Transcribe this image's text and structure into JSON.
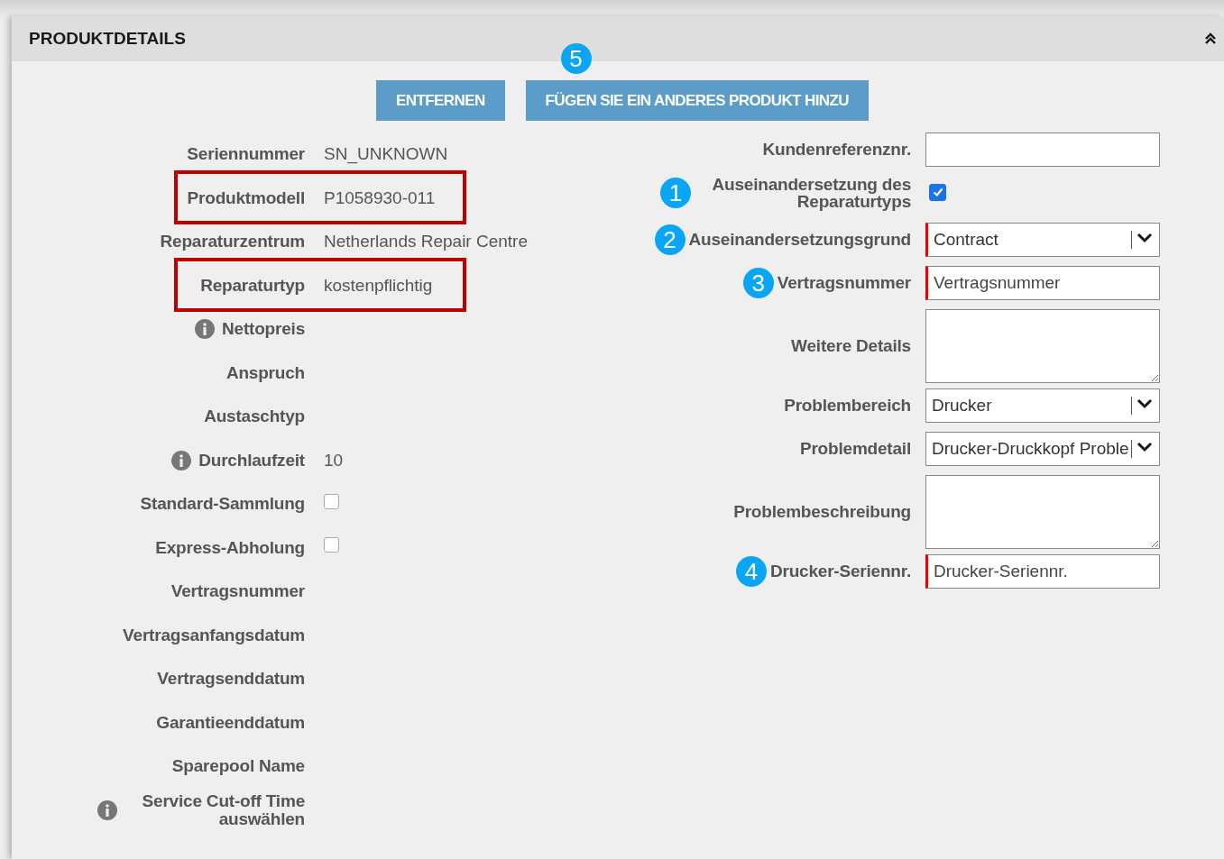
{
  "panel": {
    "title": "PRODUKTDETAILS",
    "expanded": true
  },
  "buttons": [
    {
      "label": "ENTFERNEN"
    },
    {
      "label": "FÜGEN SIE EIN ANDERES PRODUKT HINZU",
      "badge": "5"
    }
  ],
  "left_fields": [
    {
      "kind": "text",
      "label": "Seriennummer",
      "value": "SN_UNKNOWN",
      "info": false,
      "highlighted": false
    },
    {
      "kind": "text",
      "label": "Produktmodell",
      "value": "P1058930-011",
      "info": false,
      "highlighted": true
    },
    {
      "kind": "text",
      "label": "Reparaturzentrum",
      "value": "Netherlands Repair Centre",
      "info": false,
      "highlighted": false
    },
    {
      "kind": "text",
      "label": "Reparaturtyp",
      "value": "kostenpflichtig",
      "info": false,
      "highlighted": true
    },
    {
      "kind": "text",
      "label": "Nettopreis",
      "info": true,
      "highlighted": false
    },
    {
      "kind": "text",
      "label": "Anspruch",
      "info": false,
      "highlighted": false
    },
    {
      "kind": "text",
      "label": "Austaschtyp",
      "info": false,
      "highlighted": false
    },
    {
      "kind": "text",
      "label": "Durchlaufzeit",
      "value": "10",
      "info": true,
      "highlighted": false
    },
    {
      "kind": "checkbox",
      "label": "Standard-Sammlung",
      "checked": false,
      "info": false,
      "highlighted": false
    },
    {
      "kind": "checkbox",
      "label": "Express-Abholung",
      "checked": false,
      "info": false,
      "highlighted": false
    },
    {
      "kind": "text",
      "label": "Vertragsnummer",
      "info": false,
      "highlighted": false
    },
    {
      "kind": "text",
      "label": "Vertragsanfangsdatum",
      "info": false,
      "highlighted": false
    },
    {
      "kind": "text",
      "label": "Vertragsenddatum",
      "info": false,
      "highlighted": false
    },
    {
      "kind": "text",
      "label": "Garantieenddatum",
      "info": false,
      "highlighted": false
    },
    {
      "kind": "text",
      "label": "Sparepool Name",
      "info": false,
      "highlighted": false
    },
    {
      "kind": "text",
      "label": "Service Cut-off Time auswählen",
      "info": true,
      "highlighted": false
    }
  ],
  "right_fields": [
    {
      "kind": "input",
      "label": "Kundenreferenznr.",
      "required": false
    },
    {
      "kind": "checkbox",
      "label": "Auseinandersetzung des Reparaturtyps",
      "checked": true,
      "badge": "1"
    },
    {
      "kind": "select",
      "label": "Auseinandersetzungsgrund",
      "value": "Contract",
      "required": true,
      "badge": "2"
    },
    {
      "kind": "input",
      "label": "Vertragsnummer",
      "placeholder": "Vertragsnummer",
      "required": true,
      "badge": "3"
    },
    {
      "kind": "textarea",
      "label": "Weitere Details",
      "required": false
    },
    {
      "kind": "select",
      "label": "Problembereich",
      "value": "Drucker",
      "required": false
    },
    {
      "kind": "select",
      "label": "Problemdetail",
      "value": "Drucker-Druckkopf Proble",
      "required": false
    },
    {
      "kind": "textarea",
      "label": "Problembeschreibung",
      "required": false
    },
    {
      "kind": "input",
      "label": "Drucker-Seriennr.",
      "placeholder": "Drucker-Seriennr.",
      "required": true,
      "badge": "4"
    }
  ]
}
